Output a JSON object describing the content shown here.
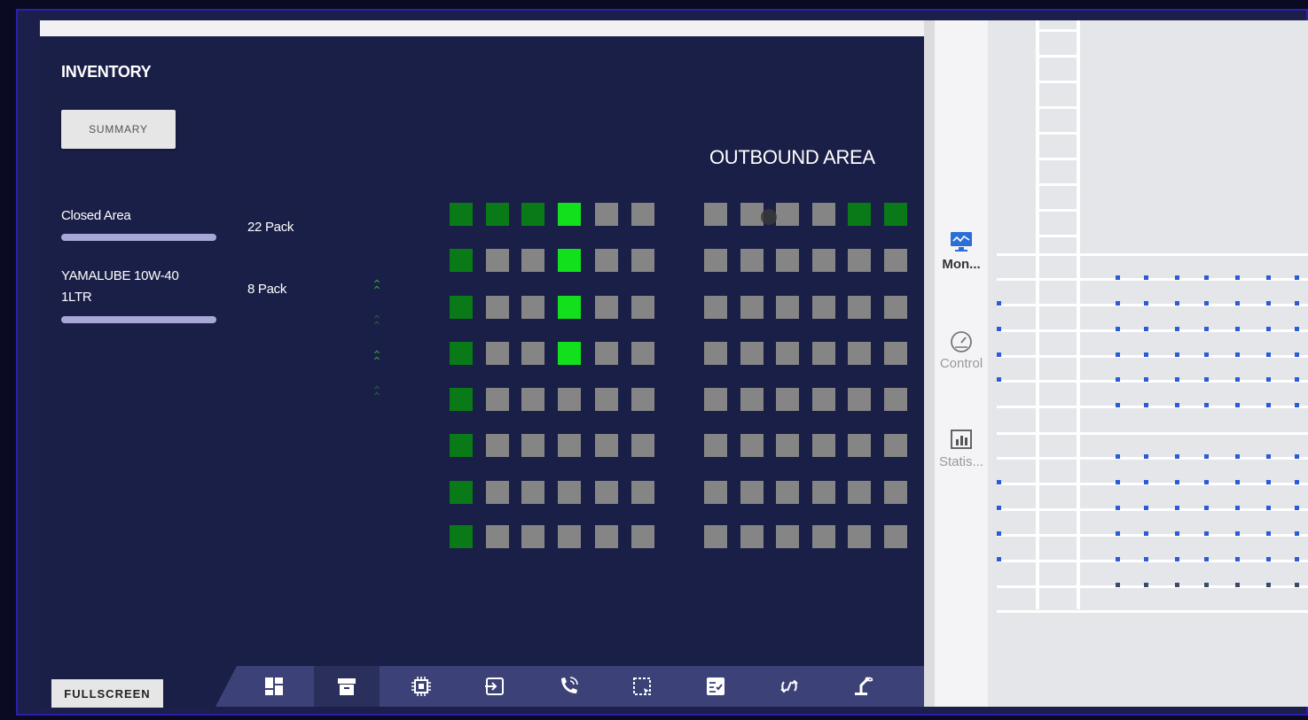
{
  "inventory": {
    "title": "INVENTORY",
    "summary_label": "SUMMARY",
    "items": [
      {
        "label": "Closed Area",
        "qty": "22 Pack"
      },
      {
        "label": "YAMALUBE 10W-40 1LTR",
        "qty": "8 Pack"
      }
    ]
  },
  "outbound": {
    "title": "OUTBOUND AREA"
  },
  "grid": {
    "left_block": [
      [
        "dg",
        "dg",
        "dg",
        "bg",
        "g",
        "g"
      ],
      [
        "dg",
        "g",
        "g",
        "bg",
        "g",
        "g"
      ],
      [
        "dg",
        "g",
        "g",
        "bg",
        "g",
        "g"
      ],
      [
        "dg",
        "g",
        "g",
        "bg",
        "g",
        "g"
      ],
      [
        "dg",
        "g",
        "g",
        "g",
        "g",
        "g"
      ],
      [
        "dg",
        "g",
        "g",
        "g",
        "g",
        "g"
      ],
      [
        "dg",
        "g",
        "g",
        "g",
        "g",
        "g"
      ],
      [
        "dg",
        "g",
        "g",
        "g",
        "g",
        "g"
      ]
    ],
    "right_block": [
      [
        "g",
        "g",
        "g",
        "g",
        "dg",
        "dg"
      ],
      [
        "g",
        "g",
        "g",
        "g",
        "g",
        "g"
      ],
      [
        "g",
        "g",
        "g",
        "g",
        "g",
        "g"
      ],
      [
        "g",
        "g",
        "g",
        "g",
        "g",
        "g"
      ],
      [
        "g",
        "g",
        "g",
        "g",
        "g",
        "g"
      ],
      [
        "g",
        "g",
        "g",
        "g",
        "g",
        "g"
      ],
      [
        "g",
        "g",
        "g",
        "g",
        "g",
        "g"
      ],
      [
        "g",
        "g",
        "g",
        "g",
        "g",
        "g"
      ]
    ],
    "colors": {
      "g": "#858585",
      "dg": "#0a7a18",
      "bg": "#12e01c"
    }
  },
  "bottom_nav": {
    "fullscreen_label": "FULLSCREEN",
    "icons": [
      "dashboard-icon",
      "archive-icon",
      "chip-icon",
      "login-icon",
      "phone-wifi-icon",
      "selection-icon",
      "checklist-icon",
      "refresh-icon",
      "robot-arm-icon"
    ],
    "active_index": 1
  },
  "side_panel": {
    "items": [
      {
        "label": "Mon...",
        "icon": "monitor-icon",
        "active": true
      },
      {
        "label": "Control",
        "icon": "gauge-icon",
        "active": false
      },
      {
        "label": "Statis...",
        "icon": "bar-chart-icon",
        "active": false
      }
    ]
  }
}
